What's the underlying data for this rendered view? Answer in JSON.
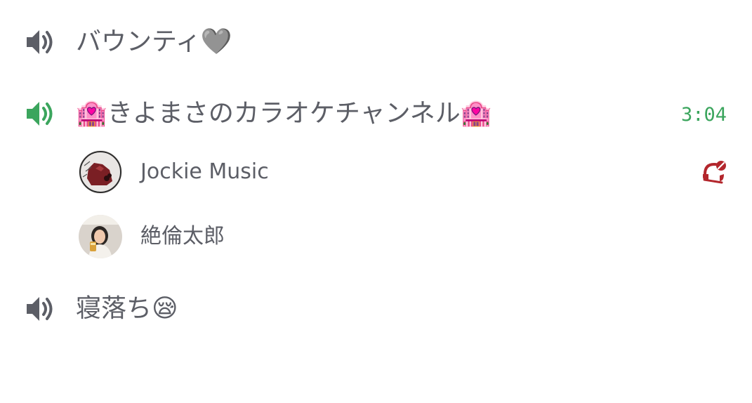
{
  "channels": [
    {
      "name": "バウンティ",
      "emoji_suffix": "🩶",
      "speaker_icon": "speaker-icon",
      "active": false
    },
    {
      "emoji_prefix": "🏩",
      "name": "きよまさのカラオケチャンネル",
      "emoji_suffix": "🏩",
      "speaker_icon": "speaker-icon",
      "active": true,
      "timer": "3:04",
      "members": [
        {
          "name": "Jockie Music",
          "avatar": "bot-avatar",
          "status_icon": "server-deafened-icon"
        },
        {
          "name": "絶倫太郎",
          "avatar": "user-avatar"
        }
      ]
    },
    {
      "name": "寝落ち",
      "emoji_suffix": "😪",
      "speaker_icon": "speaker-icon",
      "active": false
    }
  ],
  "colors": {
    "text": "#5c5e66",
    "icon_inactive": "#5c5e66",
    "icon_active": "#3ba55d",
    "timer": "#3ba55d",
    "deafened": "#b3262c"
  }
}
